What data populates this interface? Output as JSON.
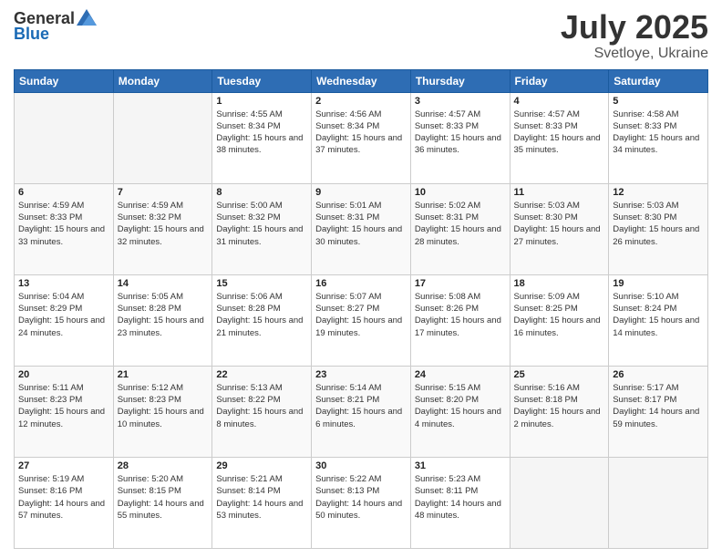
{
  "logo": {
    "general": "General",
    "blue": "Blue"
  },
  "header": {
    "month": "July 2025",
    "location": "Svetloye, Ukraine"
  },
  "weekdays": [
    "Sunday",
    "Monday",
    "Tuesday",
    "Wednesday",
    "Thursday",
    "Friday",
    "Saturday"
  ],
  "weeks": [
    [
      {
        "day": "",
        "sunrise": "",
        "sunset": "",
        "daylight": ""
      },
      {
        "day": "",
        "sunrise": "",
        "sunset": "",
        "daylight": ""
      },
      {
        "day": "1",
        "sunrise": "Sunrise: 4:55 AM",
        "sunset": "Sunset: 8:34 PM",
        "daylight": "Daylight: 15 hours and 38 minutes."
      },
      {
        "day": "2",
        "sunrise": "Sunrise: 4:56 AM",
        "sunset": "Sunset: 8:34 PM",
        "daylight": "Daylight: 15 hours and 37 minutes."
      },
      {
        "day": "3",
        "sunrise": "Sunrise: 4:57 AM",
        "sunset": "Sunset: 8:33 PM",
        "daylight": "Daylight: 15 hours and 36 minutes."
      },
      {
        "day": "4",
        "sunrise": "Sunrise: 4:57 AM",
        "sunset": "Sunset: 8:33 PM",
        "daylight": "Daylight: 15 hours and 35 minutes."
      },
      {
        "day": "5",
        "sunrise": "Sunrise: 4:58 AM",
        "sunset": "Sunset: 8:33 PM",
        "daylight": "Daylight: 15 hours and 34 minutes."
      }
    ],
    [
      {
        "day": "6",
        "sunrise": "Sunrise: 4:59 AM",
        "sunset": "Sunset: 8:33 PM",
        "daylight": "Daylight: 15 hours and 33 minutes."
      },
      {
        "day": "7",
        "sunrise": "Sunrise: 4:59 AM",
        "sunset": "Sunset: 8:32 PM",
        "daylight": "Daylight: 15 hours and 32 minutes."
      },
      {
        "day": "8",
        "sunrise": "Sunrise: 5:00 AM",
        "sunset": "Sunset: 8:32 PM",
        "daylight": "Daylight: 15 hours and 31 minutes."
      },
      {
        "day": "9",
        "sunrise": "Sunrise: 5:01 AM",
        "sunset": "Sunset: 8:31 PM",
        "daylight": "Daylight: 15 hours and 30 minutes."
      },
      {
        "day": "10",
        "sunrise": "Sunrise: 5:02 AM",
        "sunset": "Sunset: 8:31 PM",
        "daylight": "Daylight: 15 hours and 28 minutes."
      },
      {
        "day": "11",
        "sunrise": "Sunrise: 5:03 AM",
        "sunset": "Sunset: 8:30 PM",
        "daylight": "Daylight: 15 hours and 27 minutes."
      },
      {
        "day": "12",
        "sunrise": "Sunrise: 5:03 AM",
        "sunset": "Sunset: 8:30 PM",
        "daylight": "Daylight: 15 hours and 26 minutes."
      }
    ],
    [
      {
        "day": "13",
        "sunrise": "Sunrise: 5:04 AM",
        "sunset": "Sunset: 8:29 PM",
        "daylight": "Daylight: 15 hours and 24 minutes."
      },
      {
        "day": "14",
        "sunrise": "Sunrise: 5:05 AM",
        "sunset": "Sunset: 8:28 PM",
        "daylight": "Daylight: 15 hours and 23 minutes."
      },
      {
        "day": "15",
        "sunrise": "Sunrise: 5:06 AM",
        "sunset": "Sunset: 8:28 PM",
        "daylight": "Daylight: 15 hours and 21 minutes."
      },
      {
        "day": "16",
        "sunrise": "Sunrise: 5:07 AM",
        "sunset": "Sunset: 8:27 PM",
        "daylight": "Daylight: 15 hours and 19 minutes."
      },
      {
        "day": "17",
        "sunrise": "Sunrise: 5:08 AM",
        "sunset": "Sunset: 8:26 PM",
        "daylight": "Daylight: 15 hours and 17 minutes."
      },
      {
        "day": "18",
        "sunrise": "Sunrise: 5:09 AM",
        "sunset": "Sunset: 8:25 PM",
        "daylight": "Daylight: 15 hours and 16 minutes."
      },
      {
        "day": "19",
        "sunrise": "Sunrise: 5:10 AM",
        "sunset": "Sunset: 8:24 PM",
        "daylight": "Daylight: 15 hours and 14 minutes."
      }
    ],
    [
      {
        "day": "20",
        "sunrise": "Sunrise: 5:11 AM",
        "sunset": "Sunset: 8:23 PM",
        "daylight": "Daylight: 15 hours and 12 minutes."
      },
      {
        "day": "21",
        "sunrise": "Sunrise: 5:12 AM",
        "sunset": "Sunset: 8:23 PM",
        "daylight": "Daylight: 15 hours and 10 minutes."
      },
      {
        "day": "22",
        "sunrise": "Sunrise: 5:13 AM",
        "sunset": "Sunset: 8:22 PM",
        "daylight": "Daylight: 15 hours and 8 minutes."
      },
      {
        "day": "23",
        "sunrise": "Sunrise: 5:14 AM",
        "sunset": "Sunset: 8:21 PM",
        "daylight": "Daylight: 15 hours and 6 minutes."
      },
      {
        "day": "24",
        "sunrise": "Sunrise: 5:15 AM",
        "sunset": "Sunset: 8:20 PM",
        "daylight": "Daylight: 15 hours and 4 minutes."
      },
      {
        "day": "25",
        "sunrise": "Sunrise: 5:16 AM",
        "sunset": "Sunset: 8:18 PM",
        "daylight": "Daylight: 15 hours and 2 minutes."
      },
      {
        "day": "26",
        "sunrise": "Sunrise: 5:17 AM",
        "sunset": "Sunset: 8:17 PM",
        "daylight": "Daylight: 14 hours and 59 minutes."
      }
    ],
    [
      {
        "day": "27",
        "sunrise": "Sunrise: 5:19 AM",
        "sunset": "Sunset: 8:16 PM",
        "daylight": "Daylight: 14 hours and 57 minutes."
      },
      {
        "day": "28",
        "sunrise": "Sunrise: 5:20 AM",
        "sunset": "Sunset: 8:15 PM",
        "daylight": "Daylight: 14 hours and 55 minutes."
      },
      {
        "day": "29",
        "sunrise": "Sunrise: 5:21 AM",
        "sunset": "Sunset: 8:14 PM",
        "daylight": "Daylight: 14 hours and 53 minutes."
      },
      {
        "day": "30",
        "sunrise": "Sunrise: 5:22 AM",
        "sunset": "Sunset: 8:13 PM",
        "daylight": "Daylight: 14 hours and 50 minutes."
      },
      {
        "day": "31",
        "sunrise": "Sunrise: 5:23 AM",
        "sunset": "Sunset: 8:11 PM",
        "daylight": "Daylight: 14 hours and 48 minutes."
      },
      {
        "day": "",
        "sunrise": "",
        "sunset": "",
        "daylight": ""
      },
      {
        "day": "",
        "sunrise": "",
        "sunset": "",
        "daylight": ""
      }
    ]
  ]
}
